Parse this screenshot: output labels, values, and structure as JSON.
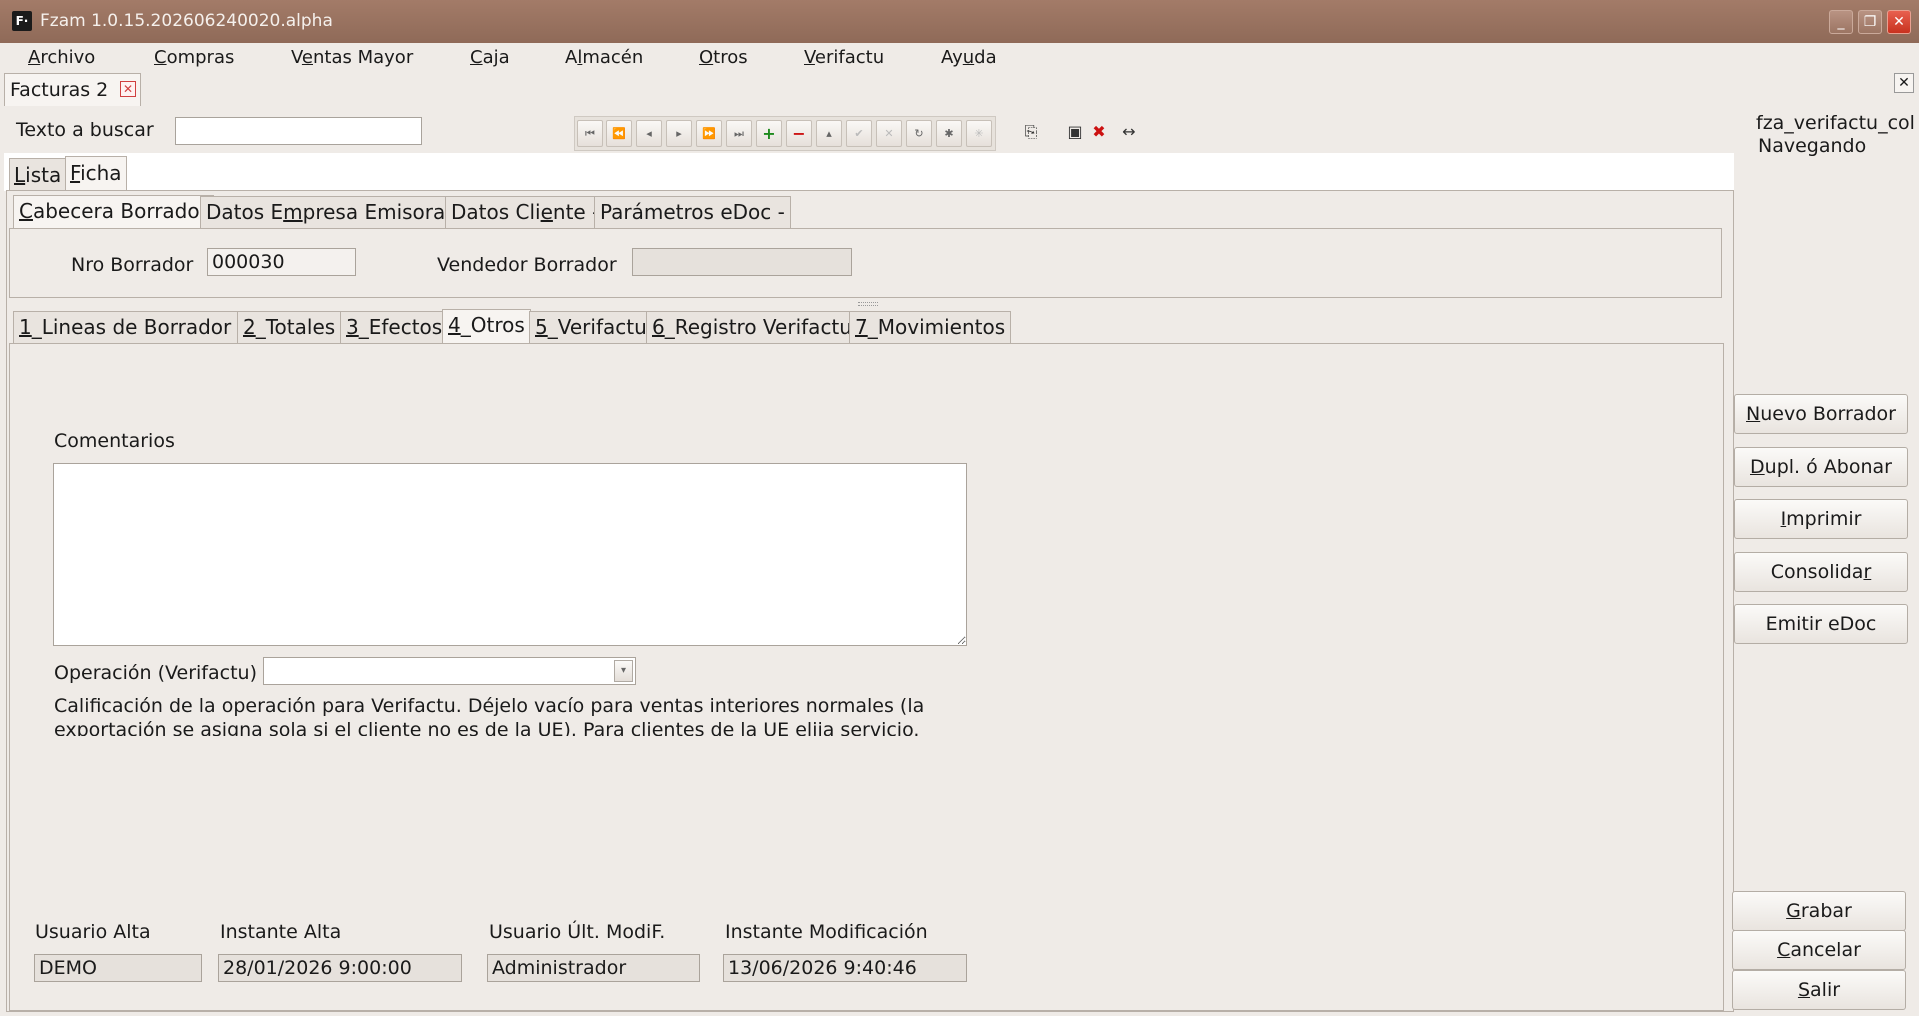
{
  "window": {
    "title": "Fzam 1.0.15.202606240020.alpha",
    "logo_text": "F·"
  },
  "menu": [
    {
      "pre": "",
      "u": "A",
      "post": "rchivo"
    },
    {
      "pre": "",
      "u": "C",
      "post": "ompras"
    },
    {
      "pre": "V",
      "u": "e",
      "post": "ntas Mayor"
    },
    {
      "pre": "",
      "u": "C",
      "post": "aja"
    },
    {
      "pre": "A",
      "u": "l",
      "post": "macén"
    },
    {
      "pre": "",
      "u": "O",
      "post": "tros"
    },
    {
      "pre": "",
      "u": "V",
      "post": "erifactu"
    },
    {
      "pre": "Ay",
      "u": "u",
      "post": "da"
    }
  ],
  "doc_tab": {
    "label": "Facturas 2"
  },
  "search": {
    "label": "Texto a buscar",
    "value": ""
  },
  "status": {
    "name": "fza_verifactu_col",
    "state": "Navegando"
  },
  "main_tabs": [
    {
      "u": "L",
      "post": "ista"
    },
    {
      "u": "F",
      "post": "icha"
    }
  ],
  "header_tabs": [
    {
      "pre": "",
      "u": "C",
      "post": "abecera Borrador"
    },
    {
      "pre": "Datos E",
      "u": "m",
      "post": "presa Emisora -"
    },
    {
      "pre": "Datos Cli",
      "u": "e",
      "post": "nte -"
    },
    {
      "pre": "Parámetros eDoc -",
      "u": "",
      "post": ""
    }
  ],
  "header": {
    "nro_label": "Nro Borrador",
    "nro_value": "000030",
    "vendedor_label": "Vendedor Borrador",
    "vendedor_value": ""
  },
  "detail_tabs": [
    {
      "u": "1",
      "post": "_Lineas de Borrador -"
    },
    {
      "u": "2",
      "post": "_Totales"
    },
    {
      "u": "3",
      "post": "_Efectos"
    },
    {
      "u": "4",
      "post": "_Otros"
    },
    {
      "u": "5",
      "post": "_Verifactu"
    },
    {
      "u": "6",
      "post": "_Registro Verifactu"
    },
    {
      "u": "7",
      "post": "_Movimientos"
    }
  ],
  "otros": {
    "comentarios_label": "Comentarios",
    "comentarios_value": "",
    "operacion_label": "Operación (Verifactu)",
    "operacion_value": "",
    "help_text": "Calificación de la operación para Verifactu. Déjelo vacío para ventas interiores normales (la exportación se asigna sola si el cliente no es de la UE). Para clientes de la UE elija servicio."
  },
  "audit": {
    "usuario_alta_label": "Usuario Alta",
    "usuario_alta": "DEMO",
    "instante_alta_label": "Instante Alta",
    "instante_alta": "28/01/2026 9:00:00",
    "usuario_mod_label": "Usuario Últ. ModiF.",
    "usuario_mod": "Administrador",
    "instante_mod_label": "Instante Modificación",
    "instante_mod": "13/06/2026 9:40:46"
  },
  "actions": [
    {
      "pre": "",
      "u": "N",
      "post": "uevo Borrador"
    },
    {
      "pre": "",
      "u": "D",
      "post": "upl. ó Abonar"
    },
    {
      "pre": "",
      "u": "I",
      "post": "mprimir"
    },
    {
      "pre": "Consolida",
      "u": "r",
      "post": ""
    },
    {
      "pre": "Emitir eDoc",
      "u": "",
      "post": ""
    }
  ],
  "bottom_actions": [
    {
      "pre": "",
      "u": "G",
      "post": "rabar"
    },
    {
      "pre": "",
      "u": "C",
      "post": "ancelar"
    },
    {
      "pre": "",
      "u": "S",
      "post": "alir"
    }
  ]
}
